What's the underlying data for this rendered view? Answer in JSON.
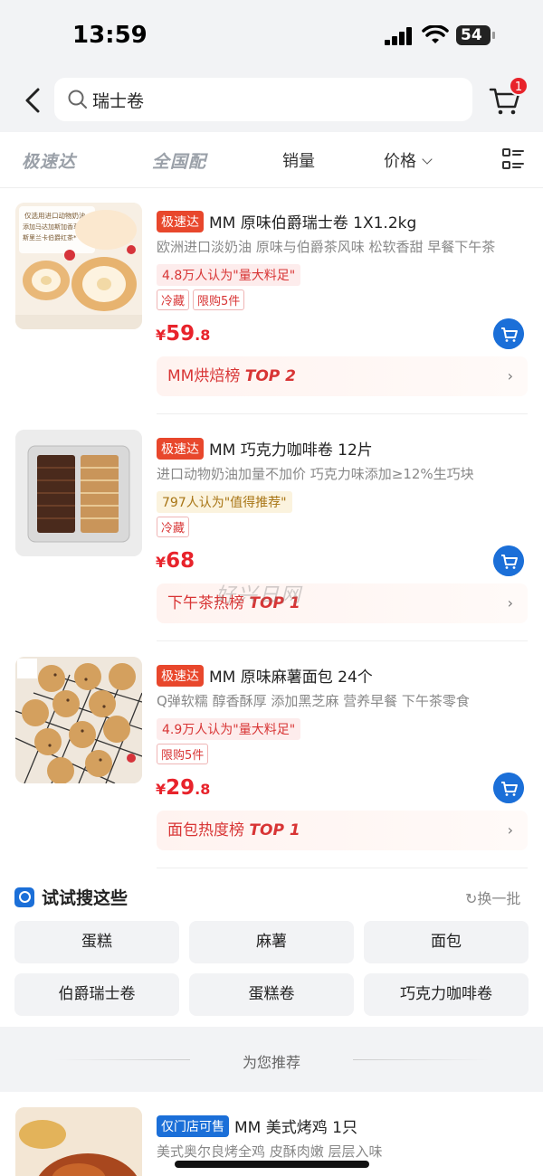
{
  "status": {
    "time": "13:59",
    "battery": "54"
  },
  "search": {
    "value": "瑞士卷"
  },
  "cart": {
    "badge": "1"
  },
  "tabs": {
    "speed": "极速达",
    "national": "全国配",
    "sales": "销量",
    "price": "价格"
  },
  "products": [
    {
      "tag": "极速达",
      "title": "MM 原味伯爵瑞士卷 1X1.2kg",
      "desc": "欧洲进口淡奶油 原味与伯爵茶风味 松软香甜 早餐下午茶",
      "rank": "4.8万人认为\"量大料足\"",
      "tags": [
        "冷藏",
        "限购5件"
      ],
      "price_int": "59",
      "price_dec": ".8",
      "rankbar_text": "MM烘焙榜 ",
      "rankbar_top": "TOP 2",
      "image_text": [
        "仅选用进口动物奶油",
        "添加马达加斯加香草籽*",
        "斯里兰卡伯爵红茶*"
      ]
    },
    {
      "tag": "极速达",
      "title": "MM 巧克力咖啡卷 12片",
      "desc": "进口动物奶油加量不加价 巧克力味添加≥12%生巧块",
      "rank": "797人认为\"值得推荐\"",
      "tags": [
        "冷藏"
      ],
      "price_int": "68",
      "price_dec": "",
      "rankbar_text": "下午茶热榜 ",
      "rankbar_top": "TOP 1"
    },
    {
      "tag": "极速达",
      "title": "MM 原味麻薯面包 24个",
      "desc": "Q弹软糯 醇香酥厚 添加黑芝麻 营养早餐 下午茶零食",
      "rank": "4.9万人认为\"量大料足\"",
      "tags": [
        "限购5件"
      ],
      "price_int": "29",
      "price_dec": ".8",
      "rankbar_text": "面包热度榜 ",
      "rankbar_top": "TOP 1"
    }
  ],
  "currency": "¥",
  "try_search": {
    "title": "试试搜这些",
    "refresh": "换一批",
    "chips": [
      "蛋糕",
      "麻薯",
      "面包",
      "伯爵瑞士卷",
      "蛋糕卷",
      "巧克力咖啡卷"
    ]
  },
  "recommend": {
    "title": "为您推荐"
  },
  "rec_product": {
    "tag": "仅门店可售",
    "title": "MM 美式烤鸡 1只",
    "desc": "美式奥尔良烤全鸡 皮酥肉嫩 层层入味"
  },
  "watermark": "好兴日网",
  "colors": {
    "brand_blue": "#1b6fd8",
    "price_red": "#e8232b",
    "speed_tag": "#e8472c"
  }
}
